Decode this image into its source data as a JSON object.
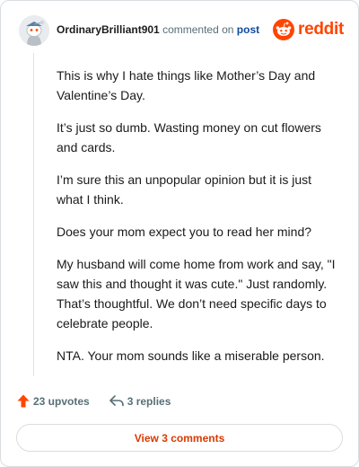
{
  "header": {
    "username": "OrdinaryBrilliant901",
    "commented_on": "commented on",
    "post_link": "post",
    "brand": "reddit"
  },
  "comment": {
    "paragraphs": [
      "This is why I hate things like Mother’s Day and Valentine’s Day.",
      "It’s just so dumb. Wasting money on cut flowers and cards.",
      "I’m sure this an unpopular opinion but it is just what I think.",
      "Does your mom expect you to read her mind?",
      "My husband will come home from work and say, \"I saw this and thought it was cute.\" Just randomly. That’s thoughtful. We don’t need specific days to celebrate people.",
      "NTA. Your mom sounds like a miserable person."
    ]
  },
  "actions": {
    "upvotes": "23 upvotes",
    "replies": "3 replies"
  },
  "footer": {
    "view_comments": "View 3 comments"
  },
  "colors": {
    "brand": "#ff4500",
    "link": "#0f4a9e",
    "button_text": "#d93a00"
  },
  "icons": {
    "avatar": "snoo-avatar",
    "logo": "reddit-alien-icon",
    "upvote": "upvote-arrow-icon",
    "reply": "reply-arrow-icon"
  }
}
